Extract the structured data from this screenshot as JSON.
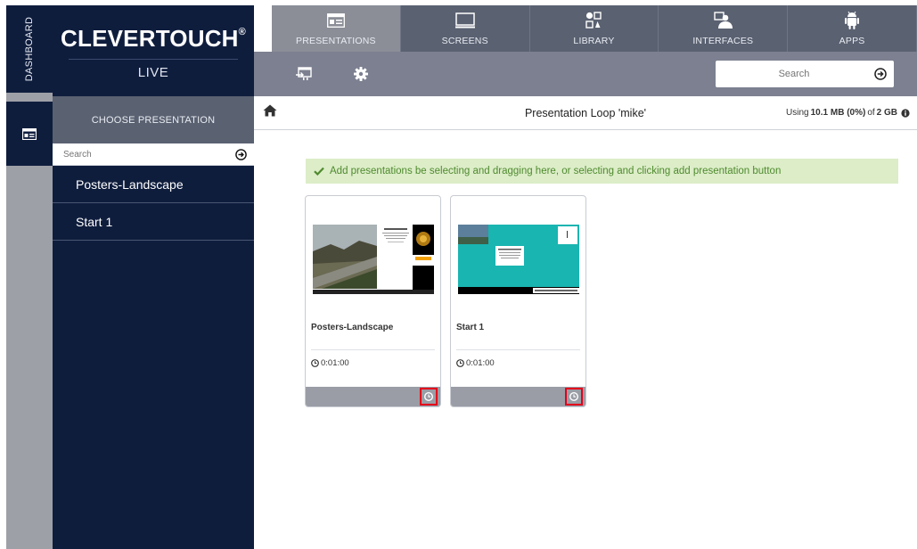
{
  "rail": {
    "dashboard_label": "DASHBOARD",
    "selected_icon": "presentation-icon"
  },
  "brand": {
    "title": "CLEVERTOUCH",
    "registered": "®",
    "subtitle": "LIVE"
  },
  "sidebar": {
    "header": "CHOOSE PRESENTATION",
    "search_placeholder": "Search",
    "items": [
      {
        "label": "Posters-Landscape"
      },
      {
        "label": "Start 1"
      }
    ]
  },
  "topnav": {
    "tabs": [
      {
        "label": "PRESENTATIONS",
        "icon": "presentation-icon",
        "active": true
      },
      {
        "label": "SCREENS",
        "icon": "monitor-icon",
        "active": false
      },
      {
        "label": "LIBRARY",
        "icon": "library-icon",
        "active": false
      },
      {
        "label": "INTERFACES",
        "icon": "interfaces-icon",
        "active": false
      },
      {
        "label": "APPS",
        "icon": "android-icon",
        "active": false
      }
    ]
  },
  "toolbar": {
    "icons": [
      "add-to-loop-icon",
      "gear-icon"
    ],
    "search_placeholder": "Search"
  },
  "content": {
    "title": "Presentation Loop 'mike'",
    "usage_prefix": "Using ",
    "usage_amount": "10.1 MB (0%)",
    "usage_mid": " of ",
    "usage_total": "2 GB",
    "alert": "Add presentations be selecting and dragging here, or selecting and clicking add presentation button"
  },
  "cards": [
    {
      "name": "Posters-Landscape",
      "time": "0:01:00"
    },
    {
      "name": "Start 1",
      "time": "0:01:00"
    }
  ],
  "colors": {
    "navy": "#0f1d3d",
    "nav_gray": "#5a6171",
    "toolbar_gray": "#7c8090",
    "alert_bg": "#dcedc8",
    "alert_text": "#4f8a2e",
    "highlight_red": "#e3001b"
  }
}
